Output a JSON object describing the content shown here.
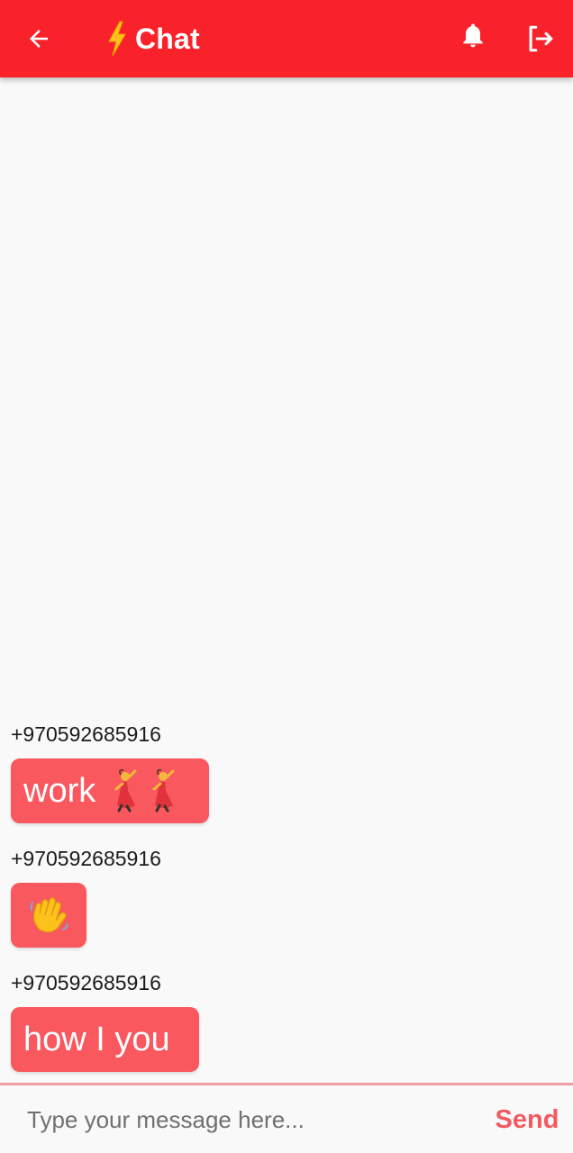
{
  "app_bar": {
    "title": "Chat",
    "background_color": "#fa222a",
    "icons": {
      "back": "arrow-back-icon",
      "title_emoji": "lightning-bolt-icon",
      "notifications": "bell-icon",
      "logout": "logout-icon"
    }
  },
  "messages": [
    {
      "sender": "+970592685916",
      "text": "work",
      "emoji": "dancer-icon x2"
    },
    {
      "sender": "+970592685916",
      "text": "",
      "emoji": "waving-hand-icon"
    },
    {
      "sender": "+970592685916",
      "text": "how I you",
      "emoji": ""
    }
  ],
  "composer": {
    "placeholder": "Type your message here...",
    "send_label": "Send",
    "accent_color": "#f25a60"
  },
  "bubble_color": "#f9585f"
}
